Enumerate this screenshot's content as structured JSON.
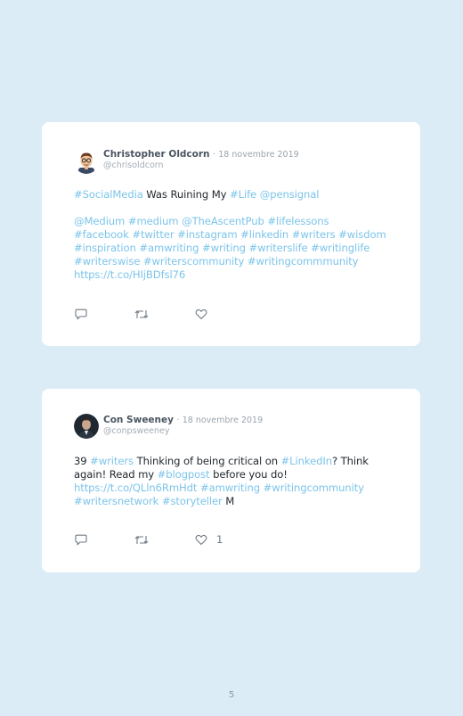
{
  "tweets": [
    {
      "name": "Christopher Oldcorn",
      "dot": "·",
      "date": "18 novembre 2019",
      "handle": "@chrisoldcorn",
      "lines": [
        [
          {
            "t": "#SocialMedia",
            "link": true
          },
          {
            "t": " Was Ruining My ",
            "link": false
          },
          {
            "t": "#Life",
            "link": true
          },
          {
            "t": " ",
            "link": false
          },
          {
            "t": "@pensignal",
            "link": true
          }
        ],
        [],
        [
          {
            "t": "@Medium #medium @TheAscentPub #lifelessons",
            "link": true
          }
        ],
        [
          {
            "t": "#facebook #twitter #instagram #linkedin #writers #wisdom",
            "link": true
          }
        ],
        [
          {
            "t": "#inspiration #amwriting #writing #writerslife #writinglife",
            "link": true
          }
        ],
        [
          {
            "t": "#writerswise #writerscommunity #writingcommmunity",
            "link": true
          }
        ],
        [
          {
            "t": "https://t.co/HIjBDfsl76",
            "link": true
          }
        ]
      ],
      "like_count": ""
    },
    {
      "name": "Con Sweeney",
      "dot": "·",
      "date": "18 novembre 2019",
      "handle": "@conpsweeney",
      "lines": [
        [
          {
            "t": "39 ",
            "link": false
          },
          {
            "t": "#writers",
            "link": true
          },
          {
            "t": " Thinking of being critical on ",
            "link": false
          },
          {
            "t": "#LinkedIn",
            "link": true
          },
          {
            "t": "? Think",
            "link": false
          }
        ],
        [
          {
            "t": "again! Read my ",
            "link": false
          },
          {
            "t": "#blogpost",
            "link": true
          },
          {
            "t": " before you do!",
            "link": false
          }
        ],
        [
          {
            "t": "https://t.co/QLln6RmHdt #amwriting #writingcommunity",
            "link": true
          }
        ],
        [
          {
            "t": "#writersnetwork #storyteller",
            "link": true
          },
          {
            "t": " M",
            "link": false
          }
        ]
      ],
      "like_count": "1"
    }
  ],
  "page_number": "5",
  "colors": {
    "background": "#dcecf6",
    "card": "#ffffff",
    "link": "#7cc4ea",
    "text": "#222a30",
    "name": "#4a5560",
    "muted": "#a3adb6"
  },
  "icons": {
    "reply": "reply-icon",
    "retweet": "retweet-icon",
    "like": "heart-icon"
  }
}
